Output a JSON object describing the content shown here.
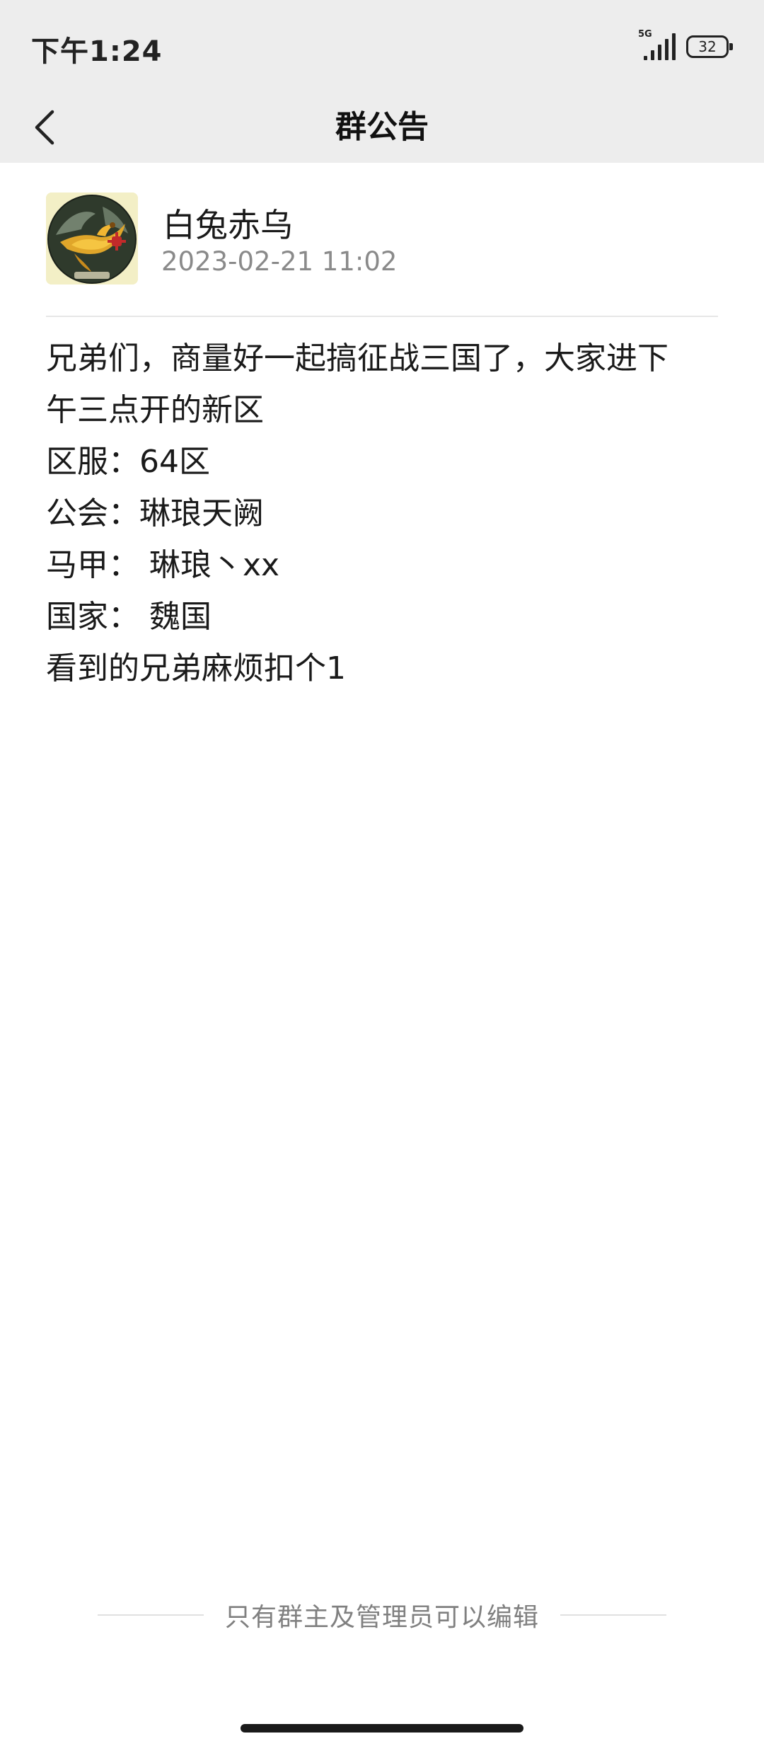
{
  "status_bar": {
    "time": "下午1:24",
    "network": "5G",
    "battery": "32"
  },
  "nav": {
    "title": "群公告",
    "back_icon": "chevron-left-icon"
  },
  "announcement": {
    "author_name": "白兔赤乌",
    "timestamp": "2023-02-21 11:02",
    "body_lines": [
      "兄弟们，商量好一起搞征战三国了，大家进下",
      "午三点开的新区",
      "区服：64区",
      "公会：琳琅天阙",
      "马甲： 琳琅丶xx",
      "国家： 魏国",
      "看到的兄弟麻烦扣个1"
    ]
  },
  "footer": {
    "note": "只有群主及管理员可以编辑"
  }
}
